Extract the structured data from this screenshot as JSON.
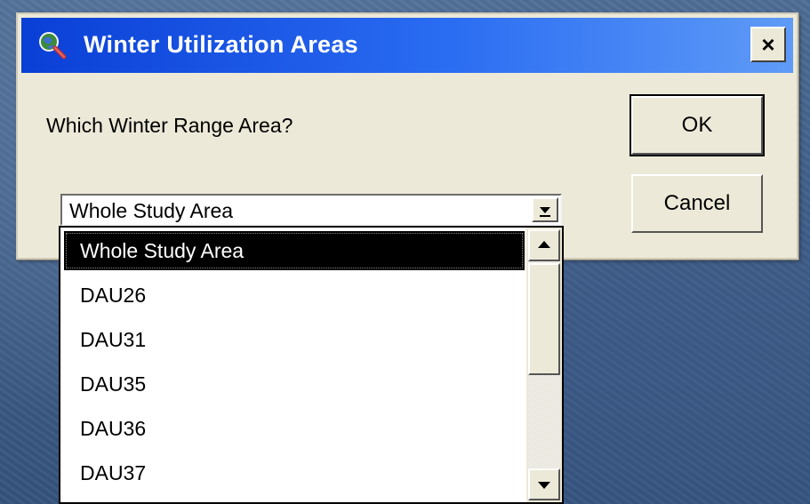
{
  "dialog": {
    "title": "Winter Utilization Areas",
    "title_icon": "magnifier-globe-icon",
    "close_label": "×",
    "prompt": "Which Winter Range Area?",
    "ok_label": "OK",
    "cancel_label": "Cancel"
  },
  "combo": {
    "selected_value": "Whole Study Area",
    "options": [
      "Whole Study Area",
      "DAU26",
      "DAU31",
      "DAU35",
      "DAU36",
      "DAU37"
    ]
  },
  "colors": {
    "titlebar_start": "#0a3fd6",
    "titlebar_end": "#5f9bf7",
    "dialog_face": "#ece9d8",
    "selection": "#000000"
  }
}
